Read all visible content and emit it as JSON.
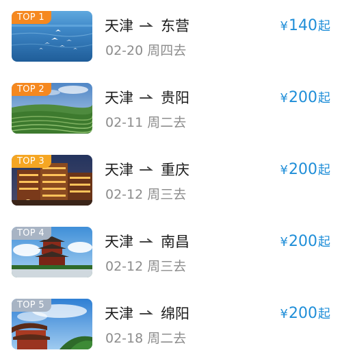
{
  "destinations": [
    {
      "rank": "TOP 1",
      "badge_color": "#F5881F",
      "from": "天津",
      "to": "东营",
      "date": "02-20",
      "weekday_go": "周四去",
      "currency": "¥",
      "price": "140",
      "price_suffix": "起",
      "thumb_icon": "seagulls-sea-photo"
    },
    {
      "rank": "TOP 2",
      "badge_color": "#F5881F",
      "from": "天津",
      "to": "贵阳",
      "date": "02-11",
      "weekday_go": "周二去",
      "currency": "¥",
      "price": "200",
      "price_suffix": "起",
      "thumb_icon": "terraced-fields-photo"
    },
    {
      "rank": "TOP 3",
      "badge_color": "#F5A623",
      "from": "天津",
      "to": "重庆",
      "date": "02-12",
      "weekday_go": "周三去",
      "currency": "¥",
      "price": "200",
      "price_suffix": "起",
      "thumb_icon": "night-buildings-photo"
    },
    {
      "rank": "TOP 4",
      "badge_color": "#A8B4C4",
      "from": "天津",
      "to": "南昌",
      "date": "02-12",
      "weekday_go": "周三去",
      "currency": "¥",
      "price": "200",
      "price_suffix": "起",
      "thumb_icon": "pavilion-tower-photo"
    },
    {
      "rank": "TOP 5",
      "badge_color": "#A8B4C4",
      "from": "天津",
      "to": "绵阳",
      "date": "02-18",
      "weekday_go": "周二去",
      "currency": "¥",
      "price": "200",
      "price_suffix": "起",
      "thumb_icon": "temple-roof-photo"
    }
  ],
  "colors": {
    "price": "#1f8ed8",
    "route_text": "#1c1c1c",
    "date_text": "#8c8c8c",
    "arrow": "#444444"
  }
}
